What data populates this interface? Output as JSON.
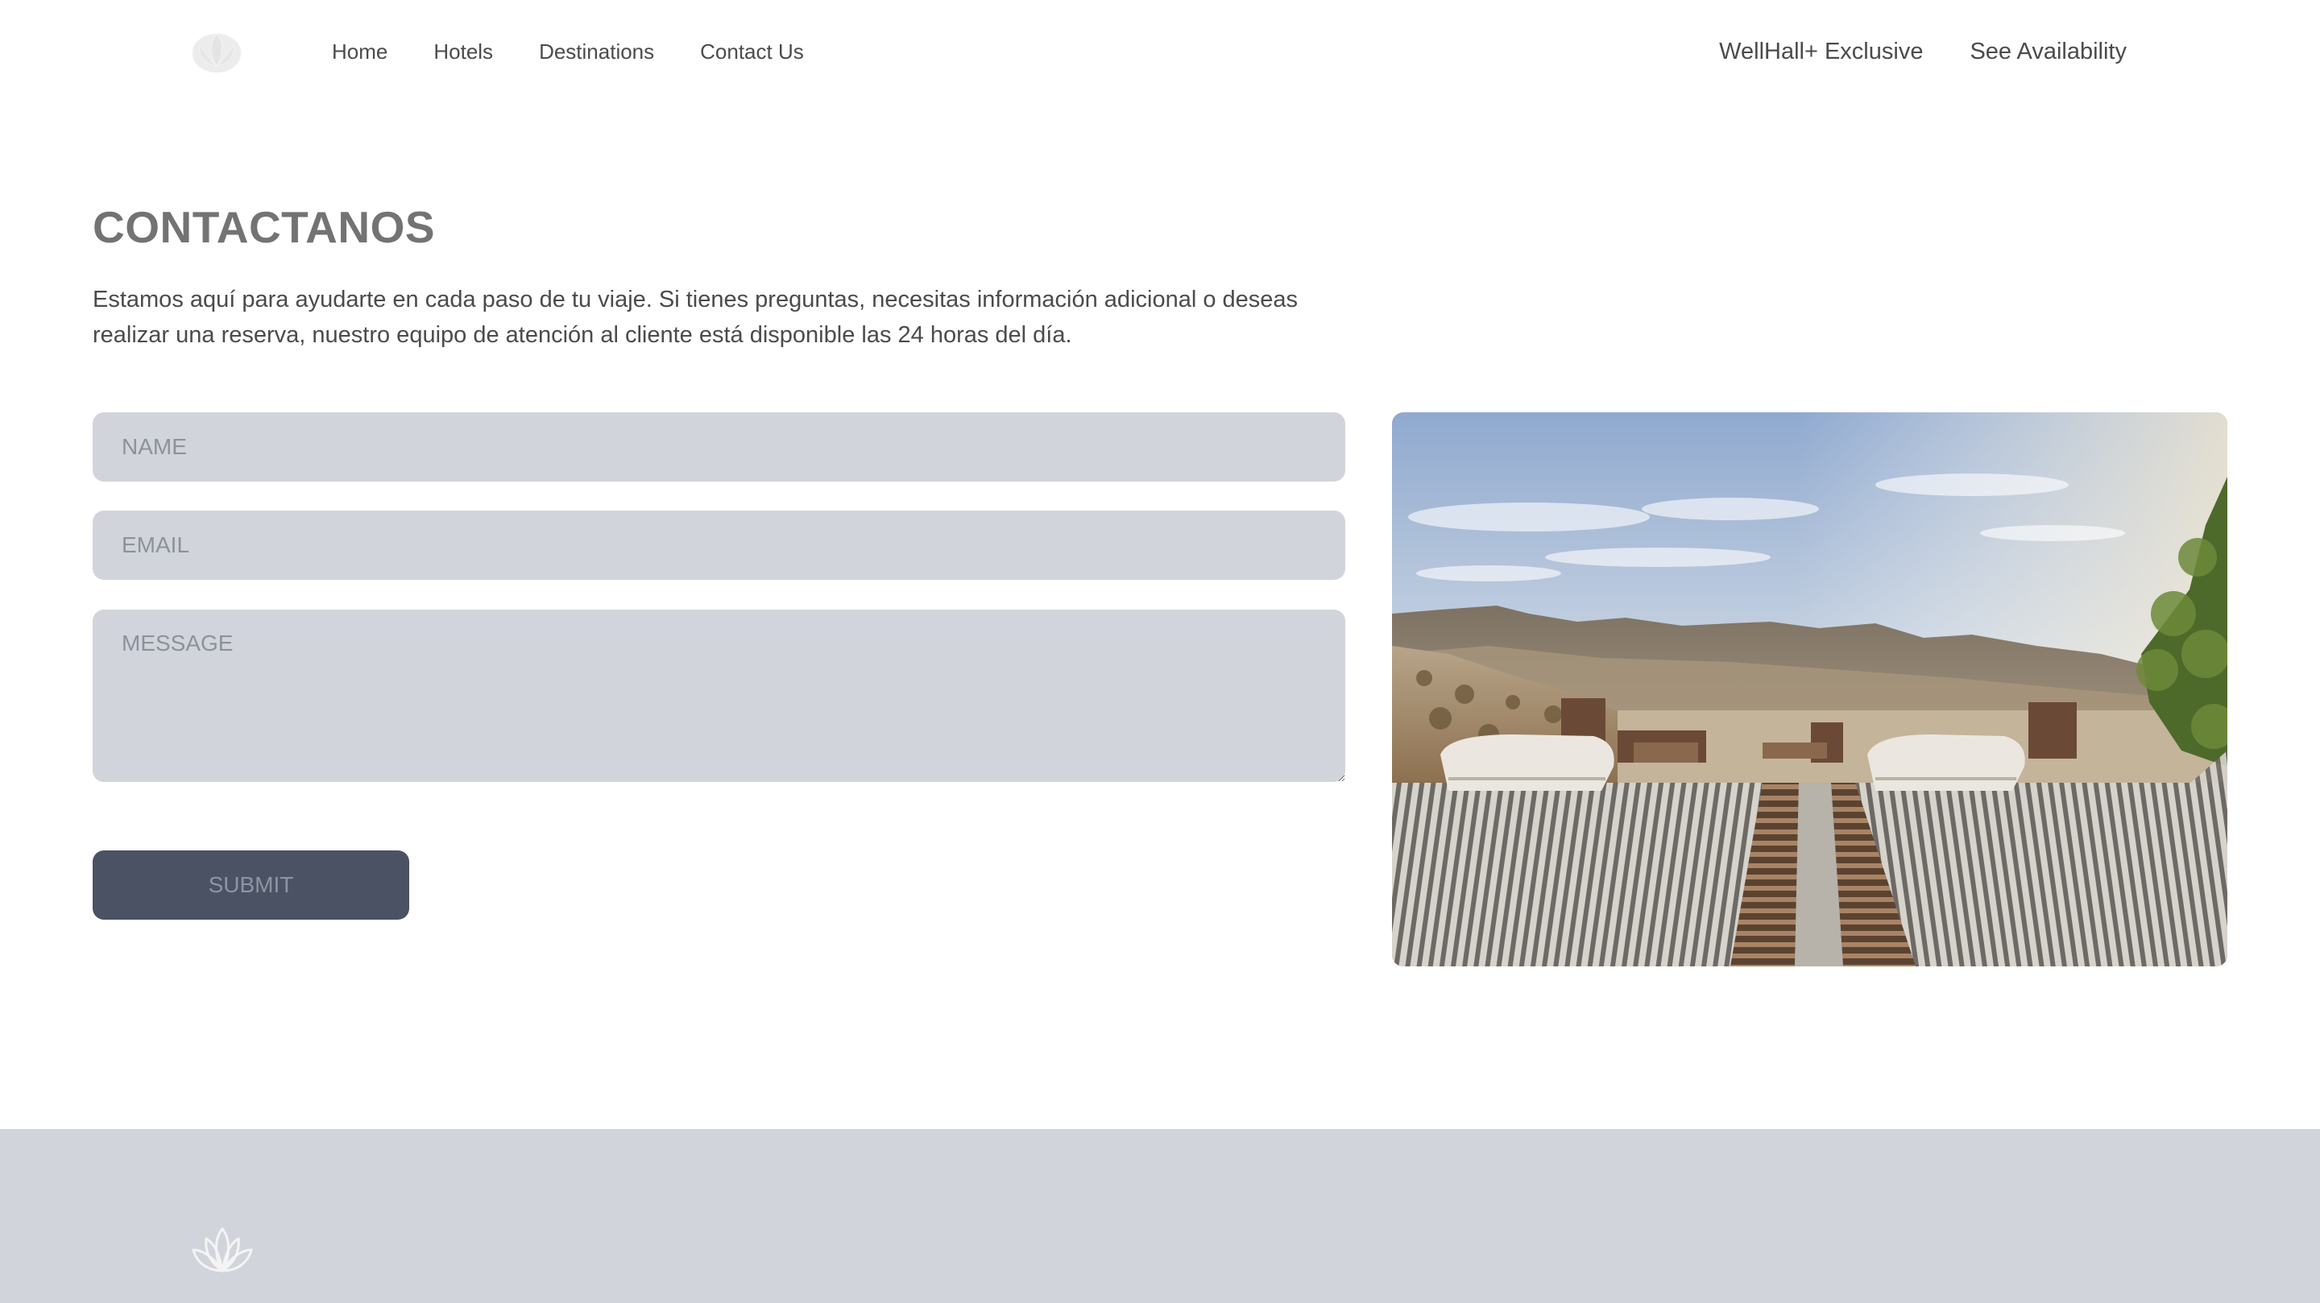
{
  "nav": {
    "links": [
      "Home",
      "Hotels",
      "Destinations",
      "Contact Us"
    ],
    "exclusive_label": "WellHall+ Exclusive",
    "availability_label": "See Availability",
    "logo_icon": "lotus-icon"
  },
  "contact": {
    "title": "CONTACTANOS",
    "intro": "Estamos aquí para ayudarte en cada paso de tu viaje. Si tienes preguntas, necesitas información adicional o deseas realizar una reserva, nuestro equipo de atención al cliente está disponible las 24 horas del día.",
    "name_placeholder": "NAME",
    "email_placeholder": "EMAIL",
    "message_placeholder": "MESSAGE",
    "submit_label": "SUBMIT"
  },
  "footer": {
    "logo_icon": "lotus-icon"
  },
  "colors": {
    "input_bg": "#d1d5db",
    "button_bg": "#4a5264",
    "footer_bg": "#d1d5db",
    "text": "#4b4b4b",
    "title": "#737373"
  }
}
